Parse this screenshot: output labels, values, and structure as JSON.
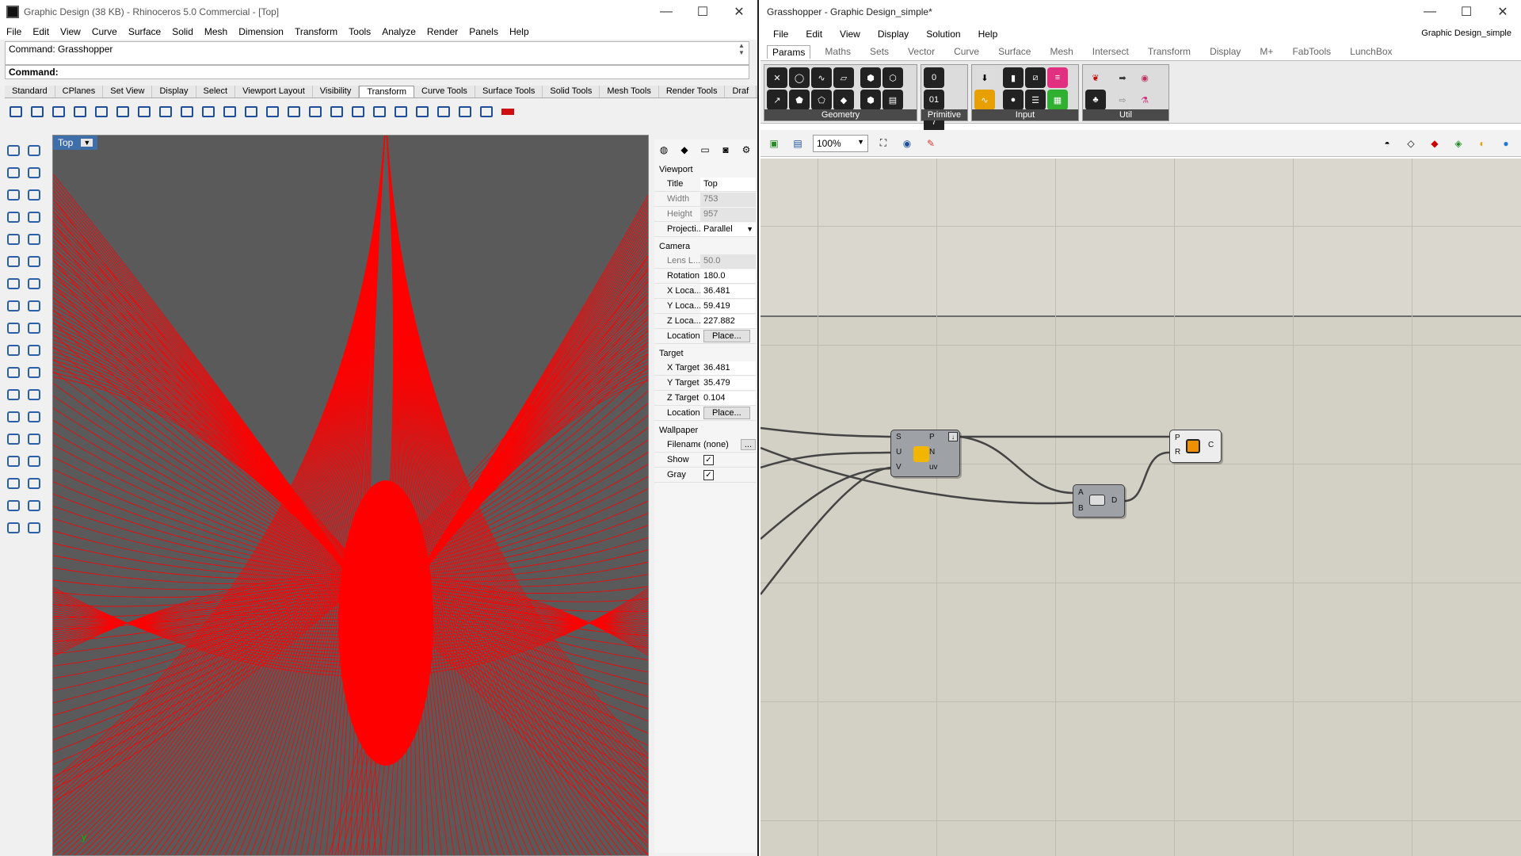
{
  "rhino": {
    "window_title": "Graphic Design (38 KB) - Rhinoceros 5.0 Commercial - [Top]",
    "menu": [
      "File",
      "Edit",
      "View",
      "Curve",
      "Surface",
      "Solid",
      "Mesh",
      "Dimension",
      "Transform",
      "Tools",
      "Analyze",
      "Render",
      "Panels",
      "Help"
    ],
    "command_history": "Command: Grasshopper",
    "command_prompt": "Command:",
    "toolbar_tabs": [
      "Standard",
      "CPlanes",
      "Set View",
      "Display",
      "Select",
      "Viewport Layout",
      "Visibility",
      "Transform",
      "Curve Tools",
      "Surface Tools",
      "Solid Tools",
      "Mesh Tools",
      "Render Tools",
      "Draf"
    ],
    "active_tab": "Transform",
    "viewport": {
      "label": "Top",
      "axis_label": "y",
      "background": "#5a5a5a",
      "curve_color": "#ff0000"
    },
    "properties": {
      "viewport_section": "Viewport",
      "title_label": "Title",
      "title_value": "Top",
      "width_label": "Width",
      "width_value": "753",
      "height_label": "Height",
      "height_value": "957",
      "projection_label": "Projecti...",
      "projection_value": "Parallel",
      "camera_section": "Camera",
      "lens_label": "Lens L...",
      "lens_value": "50.0",
      "rotation_label": "Rotation",
      "rotation_value": "180.0",
      "xloc_label": "X Loca...",
      "xloc_value": "36.481",
      "yloc_label": "Y Loca...",
      "yloc_value": "59.419",
      "zloc_label": "Z Loca...",
      "zloc_value": "227.882",
      "location_label": "Location",
      "place_button": "Place...",
      "target_section": "Target",
      "xtarget_label": "X Target",
      "xtarget_value": "36.481",
      "ytarget_label": "Y Target",
      "ytarget_value": "35.479",
      "ztarget_label": "Z Target",
      "ztarget_value": "0.104",
      "wallpaper_section": "Wallpaper",
      "filename_label": "Filename",
      "filename_value": "(none)",
      "filename_btn": "...",
      "show_label": "Show",
      "gray_label": "Gray"
    }
  },
  "grasshopper": {
    "window_title": "Grasshopper - Graphic Design_simple*",
    "doc_name": "Graphic Design_simple",
    "menu": [
      "File",
      "Edit",
      "View",
      "Display",
      "Solution",
      "Help"
    ],
    "tabs": [
      "Params",
      "Maths",
      "Sets",
      "Vector",
      "Curve",
      "Surface",
      "Mesh",
      "Intersect",
      "Transform",
      "Display",
      "M+",
      "FabTools",
      "LunchBox"
    ],
    "active_tab": "Params",
    "ribbon_groups": [
      "Geometry",
      "Primitive",
      "Input",
      "Util"
    ],
    "zoom": "100%",
    "components": {
      "eval_surface": {
        "inputs": [
          "S",
          "U",
          "V"
        ],
        "outputs": [
          "P",
          "N",
          "uv"
        ]
      },
      "distance": {
        "inputs": [
          "A",
          "B"
        ],
        "outputs": [
          "D"
        ]
      },
      "circle": {
        "inputs": [
          "P",
          "R"
        ],
        "outputs": [
          "C"
        ]
      }
    }
  },
  "window_controls": {
    "minimize": "—",
    "maximize": "☐",
    "close": "✕"
  }
}
